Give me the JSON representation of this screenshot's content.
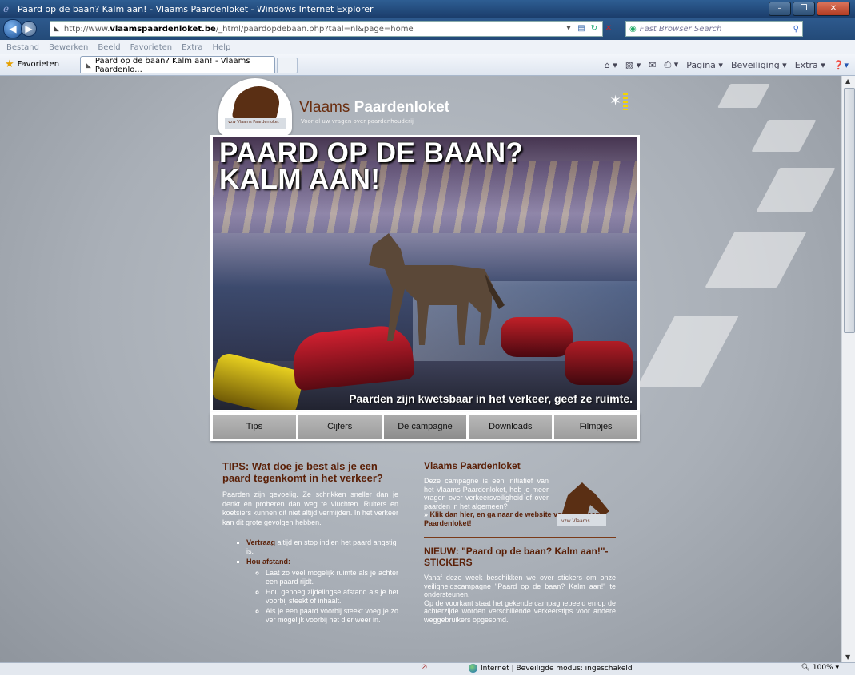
{
  "window": {
    "title": "Paard op de baan? Kalm aan! - Vlaams Paardenloket - Windows Internet Explorer",
    "min": "–",
    "max": "❐",
    "close": "✕"
  },
  "address": {
    "url_prefix": "http://www.",
    "url_domain": "vlaamspaardenloket.be",
    "url_rest": "/_html/paardopdebaan.php?taal=nl&page=home",
    "search_placeholder": "Fast Browser Search"
  },
  "menu": [
    "Bestand",
    "Bewerken",
    "Beeld",
    "Favorieten",
    "Extra",
    "Help"
  ],
  "favorites_label": "Favorieten",
  "tab_title": "Paard op de baan? Kalm aan! - Vlaams Paardenlo...",
  "commandbar": {
    "pagina": "Pagina ▾",
    "beveiliging": "Beveiliging ▾",
    "extra": "Extra ▾"
  },
  "status": {
    "zone": "Internet | Beveiligde modus: ingeschakeld",
    "zoom": "100%"
  },
  "site": {
    "title_part1": "Vlaams ",
    "title_part2": "Paardenloket",
    "tagline": "Voor al uw vragen over paardenhouderij",
    "logo_text": "vzw Vlaams Paardenloket",
    "hero_headline_1": "PAARD OP DE BAAN?",
    "hero_headline_2": "KALM AAN!",
    "hero_sub": "Paarden zijn kwetsbaar in het verkeer, geef ze ruimte.",
    "nav": [
      "Tips",
      "Cijfers",
      "De campagne",
      "Downloads",
      "Filmpjes"
    ]
  },
  "tips": {
    "heading": "TIPS: Wat doe je best als je een paard tegenkomt in het verkeer?",
    "intro": "Paarden zijn gevoelig. Ze schrikken sneller dan je denkt en proberen dan weg te vluchten. Ruiters en koetsiers kunnen dit niet altijd vermijden. In het verkeer kan dit grote gevolgen hebben.",
    "item1_bold": "Vertraag",
    "item1_rest": " altijd en stop indien het paard angstig is.",
    "item2_bold": "Hou afstand:",
    "sub1": "Laat zo veel mogelijk ruimte als je achter een paard rijdt.",
    "sub2": "Hou genoeg zijdelingse afstand als je het voorbij steekt of inhaalt.",
    "sub3": "Als je een paard voorbij steekt voeg je zo ver mogelijk voorbij het dier weer in."
  },
  "side": {
    "heading": "Vlaams Paardenloket",
    "intro": "Deze campagne is een initiatief van het Vlaams Paardenloket, heb je meer vragen over verkeersveiligheid of over paarden in het algemeen?",
    "arrow": "» ",
    "link": "Klik dan hier, en ga naar de website van het Vlaams Paardenloket!",
    "mini_logo_text": "vzw Vlaams",
    "news_heading": "NIEUW: \"Paard op de baan? Kalm aan!\"- STICKERS",
    "news_p1": "Vanaf deze week beschikken we over stickers om onze veiligheidscampagne \"Paard op de baan? Kalm aan!\" te ondersteunen.",
    "news_p2": "Op de voorkant staat het gekende campagnebeeld en op de achterzijde worden verschillende verkeerstips voor andere weggebruikers opgesomd."
  },
  "colors": {
    "accent_brown": "#5a1f06",
    "ie_blue": "#234a78"
  }
}
